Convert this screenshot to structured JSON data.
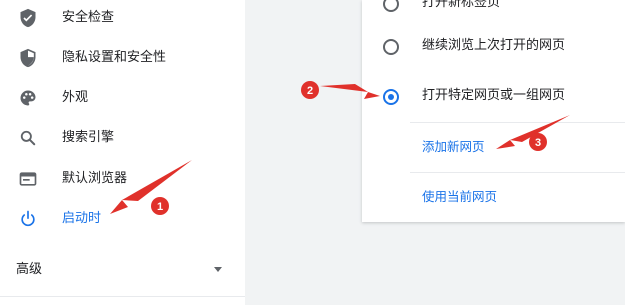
{
  "sidebar": {
    "items": [
      {
        "label": "安全检查",
        "icon": "shield-check-icon"
      },
      {
        "label": "隐私设置和安全性",
        "icon": "shield-half-icon"
      },
      {
        "label": "外观",
        "icon": "palette-icon"
      },
      {
        "label": "搜索引擎",
        "icon": "search-icon"
      },
      {
        "label": "默认浏览器",
        "icon": "browser-icon"
      },
      {
        "label": "启动时",
        "icon": "power-icon",
        "active": true
      }
    ],
    "advanced_label": "高级"
  },
  "startup": {
    "options": [
      {
        "label": "打开新标签页",
        "checked": false
      },
      {
        "label": "继续浏览上次打开的网页",
        "checked": false
      },
      {
        "label": "打开特定网页或一组网页",
        "checked": true
      }
    ],
    "add_page_link": "添加新网页",
    "use_current_link": "使用当前网页"
  },
  "annotations": {
    "markers": [
      "1",
      "2",
      "3"
    ],
    "color": "#e0312b"
  },
  "colors": {
    "accent": "#1a73e8",
    "icon": "#5f6368",
    "panel_bg": "#f1f3f4"
  }
}
